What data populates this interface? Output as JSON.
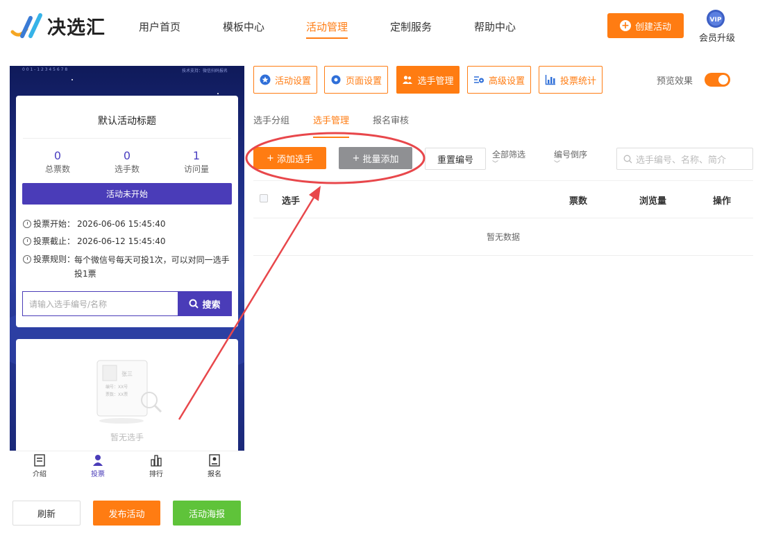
{
  "header": {
    "brand": "决选汇",
    "nav": [
      {
        "label": "用户首页",
        "active": false
      },
      {
        "label": "模板中心",
        "active": false
      },
      {
        "label": "活动管理",
        "active": true
      },
      {
        "label": "定制服务",
        "active": false
      },
      {
        "label": "帮助中心",
        "active": false
      }
    ],
    "create_button": "创建活动",
    "vip_badge": "VIP",
    "vip_label": "会员升级"
  },
  "preview": {
    "top_left_text": "0 0 1 - 1 2 3 4 5 6 7 8",
    "top_right_text": "技术支持：微信扫码报名",
    "title": "默认活动标题",
    "stats": [
      {
        "value": "0",
        "label": "总票数"
      },
      {
        "value": "0",
        "label": "选手数"
      },
      {
        "value": "1",
        "label": "访问量"
      }
    ],
    "status": "活动未开始",
    "vote_start_label": "投票开始：",
    "vote_start": "2026-06-06 15:45:40",
    "vote_end_label": "投票截止：",
    "vote_end": "2026-06-12 15:45:40",
    "rule_label": "投票规则：",
    "rule": "每个微信号每天可投1次，可以对同一选手投1票",
    "search_placeholder": "请输入选手编号/名称",
    "search_button": "搜索",
    "empty_card": {
      "name": "张三",
      "line1": "编号：XX号",
      "line2": "票数：XX票"
    },
    "empty_text": "暂无选手",
    "tabbar": [
      "介绍",
      "投票",
      "排行",
      "报名"
    ]
  },
  "bottom_buttons": {
    "refresh": "刷新",
    "publish": "发布活动",
    "poster": "活动海报"
  },
  "toolbar": {
    "items": [
      {
        "label": "活动设置",
        "active": false
      },
      {
        "label": "页面设置",
        "active": false
      },
      {
        "label": "选手管理",
        "active": true
      },
      {
        "label": "高级设置",
        "active": false
      },
      {
        "label": "投票统计",
        "active": false
      }
    ],
    "preview_label": "预览效果",
    "preview_on": true
  },
  "subtabs": [
    {
      "label": "选手分组",
      "active": false
    },
    {
      "label": "选手管理",
      "active": true
    },
    {
      "label": "报名审核",
      "active": false
    }
  ],
  "actions": {
    "add": "添加选手",
    "batch_add": "批量添加",
    "renumber": "重置编号",
    "filter_all": "全部筛选",
    "sort_order": "编号倒序",
    "search_placeholder": "选手编号、名称、简介"
  },
  "table": {
    "columns": [
      "选手",
      "票数",
      "浏览量",
      "操作"
    ],
    "empty_text": "暂无数据"
  },
  "colors": {
    "accent": "#ff7c12",
    "purple": "#4a3cb8",
    "green": "#5fc33a",
    "annotation": "#e8474b"
  }
}
